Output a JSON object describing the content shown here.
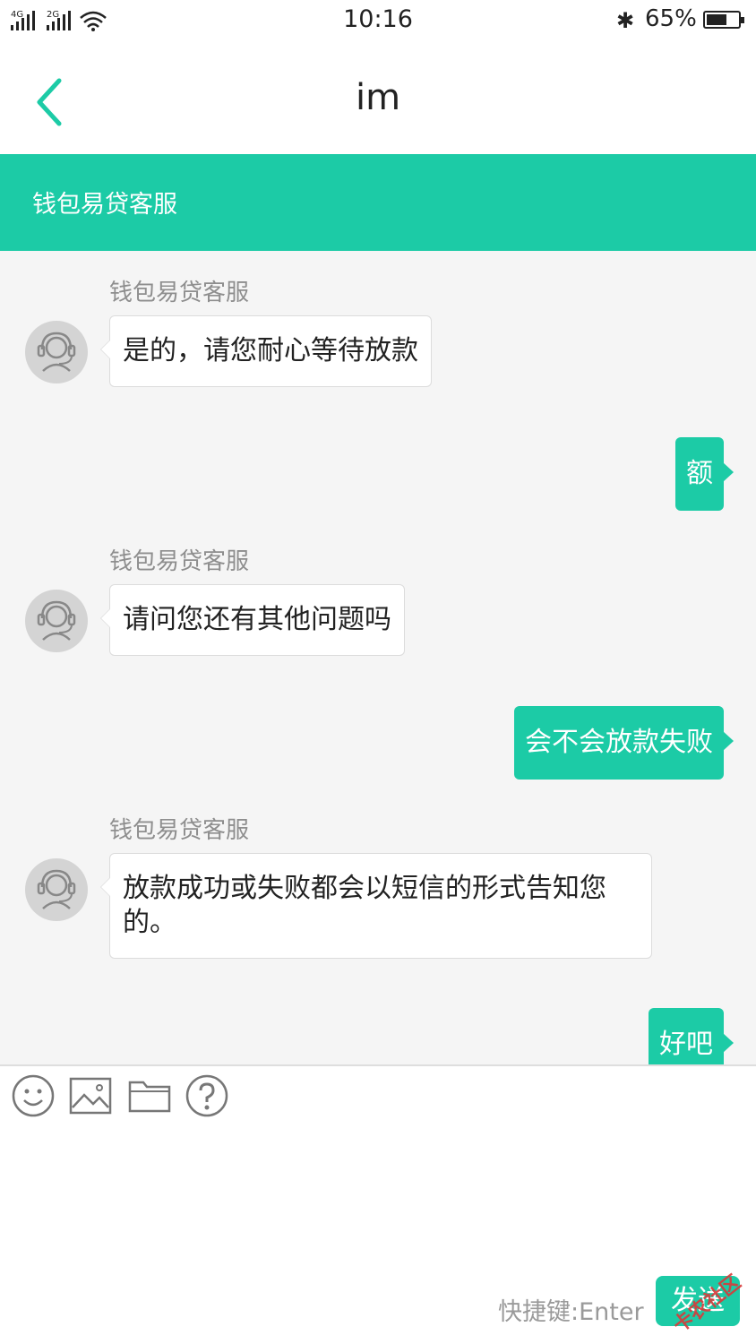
{
  "status_bar": {
    "network_1": "4G",
    "network_2": "2G",
    "time": "10:16",
    "battery_percent_text": "65%",
    "battery_level": 0.65
  },
  "nav": {
    "title": "im"
  },
  "banner": {
    "title": "钱包易贷客服"
  },
  "messages": [
    {
      "direction": "in",
      "sender": "钱包易贷客服",
      "text": "是的，请您耐心等待放款"
    },
    {
      "direction": "out",
      "text": "额"
    },
    {
      "direction": "in",
      "sender": "钱包易贷客服",
      "text": "请问您还有其他问题吗"
    },
    {
      "direction": "out",
      "text": "会不会放款失败"
    },
    {
      "direction": "in",
      "sender": "钱包易贷客服",
      "text": "放款成功或失败都会以短信的形式告知您的。"
    },
    {
      "direction": "out",
      "text": "好吧"
    }
  ],
  "toolbar": {
    "icons": [
      "emoji-icon",
      "image-icon",
      "folder-icon",
      "help-icon"
    ]
  },
  "input": {
    "hint": "快捷键:Enter",
    "send_label": "发送"
  },
  "watermark": {
    "text": "卡农社区"
  },
  "colors": {
    "accent": "#1ccba6",
    "chat_bg": "#f5f5f5"
  }
}
